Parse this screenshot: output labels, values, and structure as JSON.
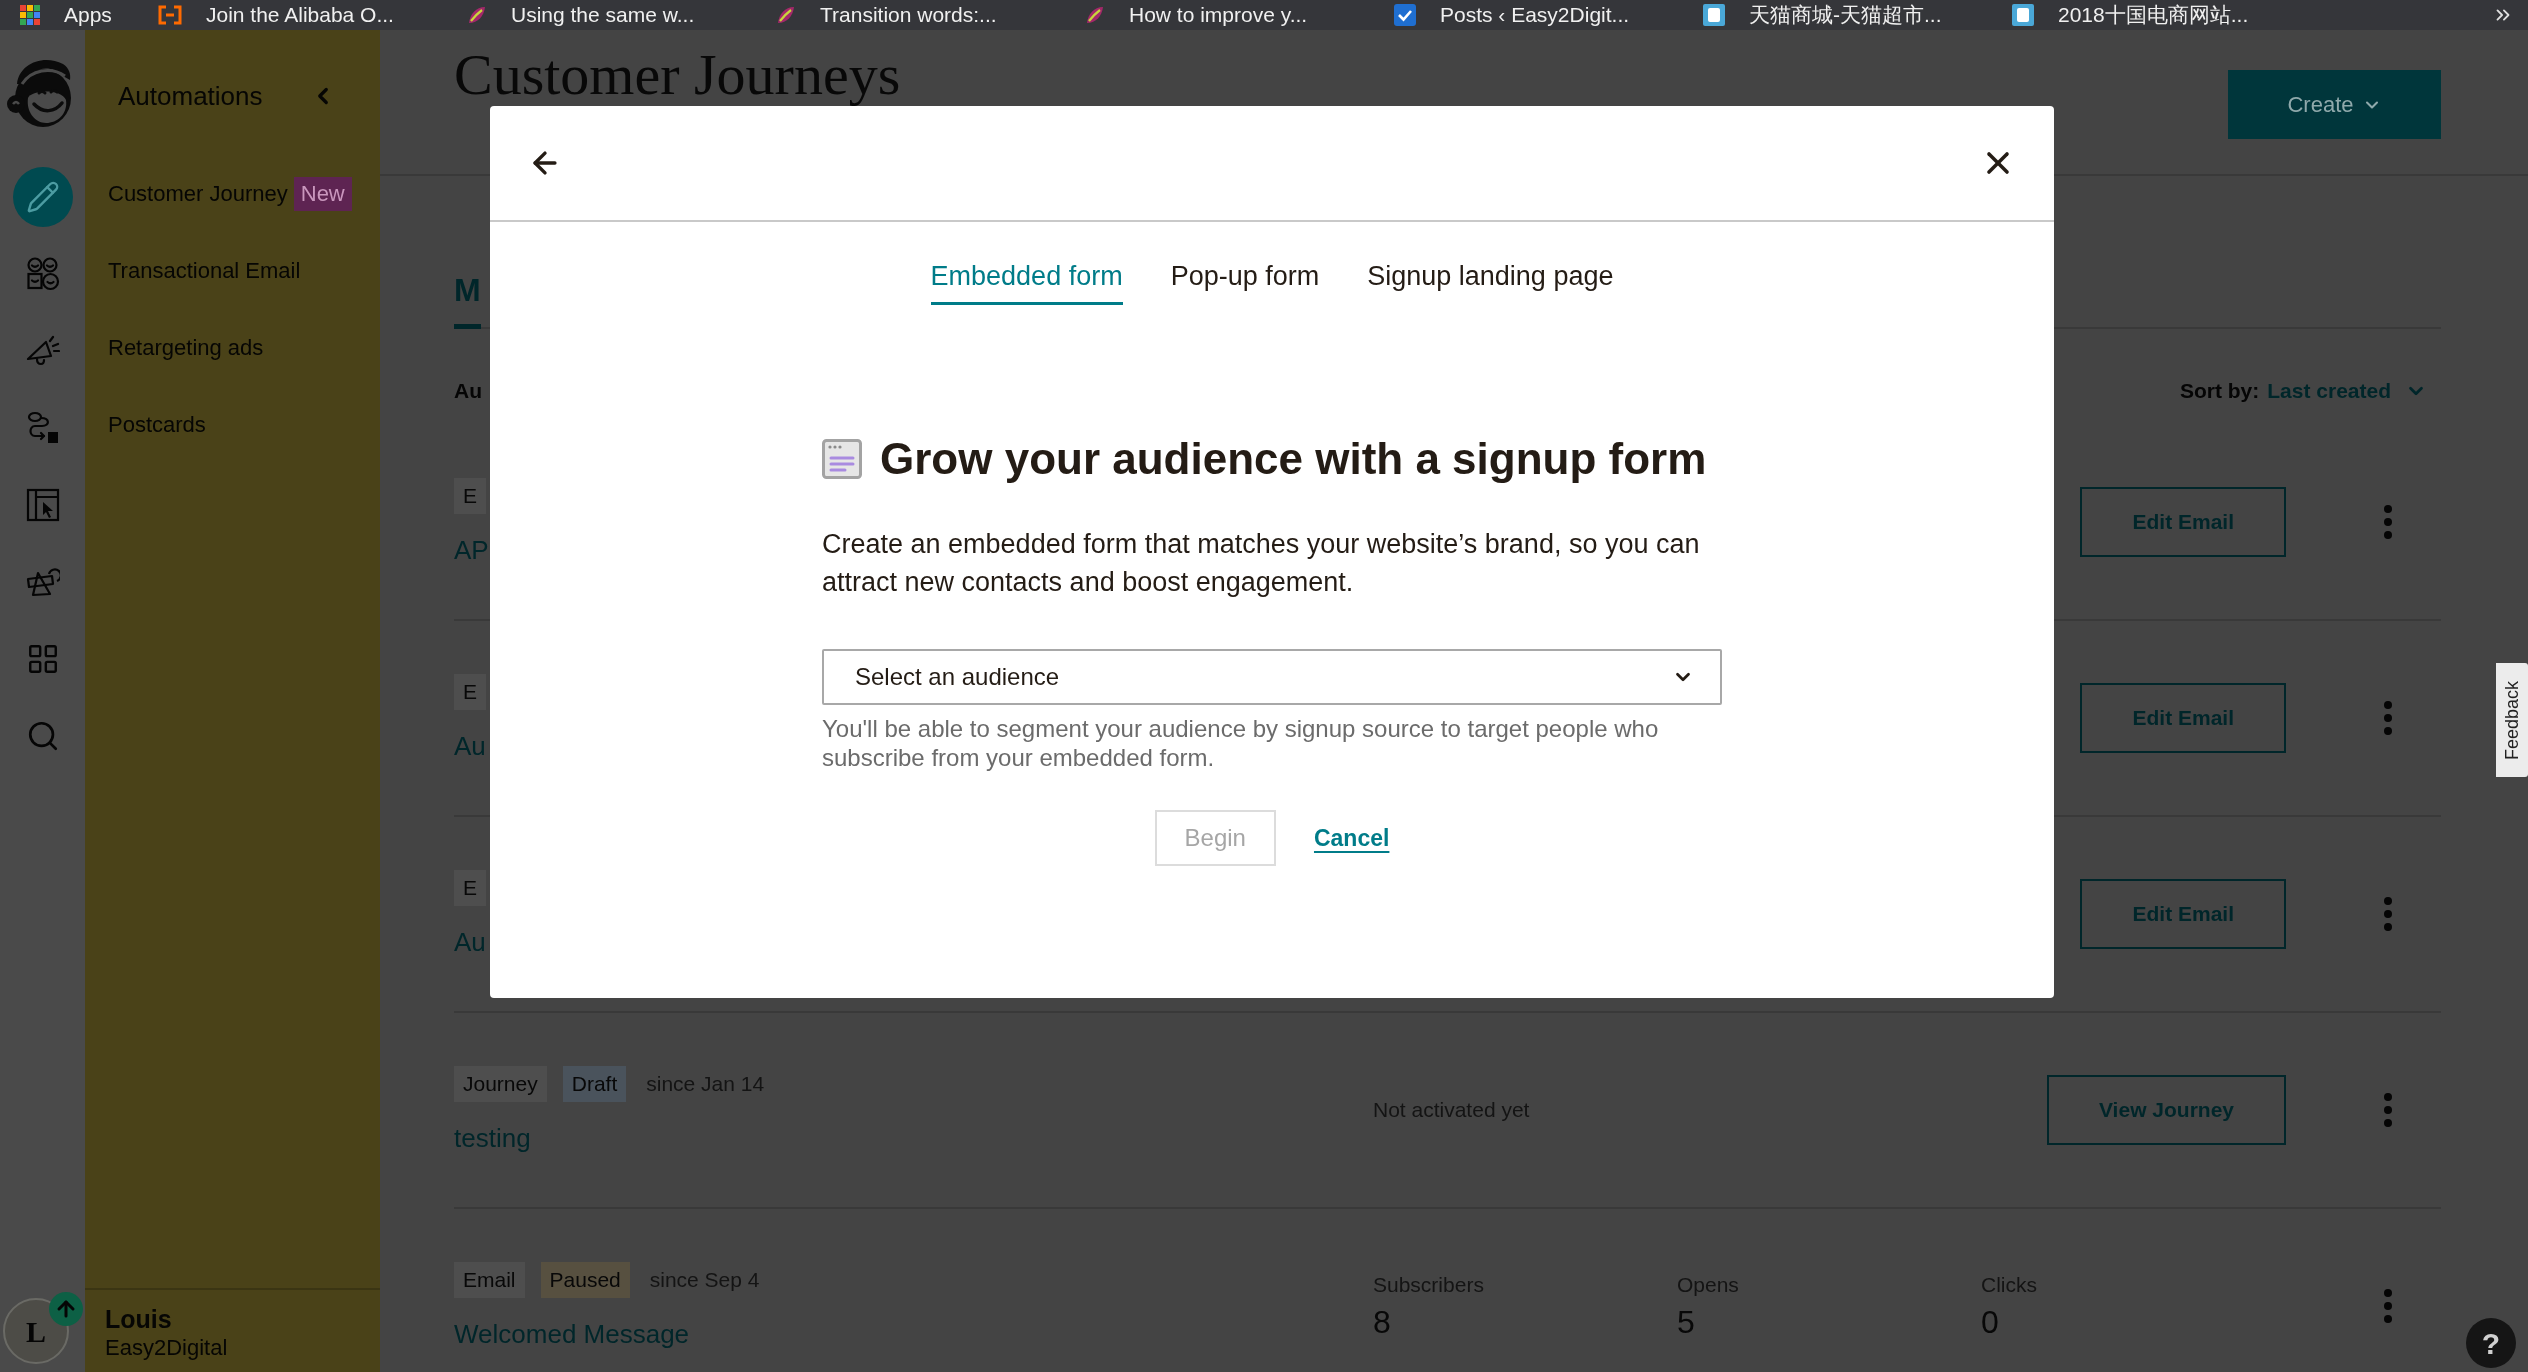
{
  "bookmarks": [
    {
      "label": "Apps"
    },
    {
      "label": "Join the Alibaba O..."
    },
    {
      "label": "Using the same w..."
    },
    {
      "label": "Transition words:..."
    },
    {
      "label": "How to improve y..."
    },
    {
      "label": "Posts ‹ Easy2Digit..."
    },
    {
      "label": "天猫商城-天猫超市..."
    },
    {
      "label": "2018十国电商网站..."
    }
  ],
  "rail": {
    "items": [
      {
        "selected": true
      },
      {
        "selected": false
      },
      {
        "selected": false
      },
      {
        "selected": false
      },
      {
        "selected": false
      },
      {
        "selected": false
      },
      {
        "selected": false
      },
      {
        "selected": false
      }
    ],
    "avatar": {
      "initial": "L"
    }
  },
  "sidebar": {
    "title": "Automations",
    "items": [
      {
        "label": "Customer Journey",
        "badge": "New"
      },
      {
        "label": "Transactional Email"
      },
      {
        "label": "Retargeting ads"
      },
      {
        "label": "Postcards"
      }
    ],
    "user": {
      "name": "Louis",
      "account": "Easy2Digital"
    }
  },
  "page": {
    "title": "Customer Journeys",
    "create_button": "Create",
    "tabs": [
      {
        "label": "M",
        "selected": true
      }
    ],
    "filter_label": "Au",
    "sort_label": "Sort by:",
    "sort_value": "Last created"
  },
  "rows": [
    {
      "tags": [
        {
          "label": "E",
          "kind": "type"
        }
      ],
      "name": "AP",
      "button": "Edit Email"
    },
    {
      "tags": [
        {
          "label": "E",
          "kind": "type"
        }
      ],
      "name": "Au",
      "button": "Edit Email"
    },
    {
      "tags": [
        {
          "label": "E",
          "kind": "type"
        }
      ],
      "name": "Au",
      "button": "Edit Email"
    },
    {
      "tags": [
        {
          "label": "Journey",
          "kind": "type"
        },
        {
          "label": "Draft",
          "kind": "draft"
        }
      ],
      "since": "since Jan 14",
      "name": "testing",
      "status": "Not activated yet",
      "button": "View Journey"
    },
    {
      "tags": [
        {
          "label": "Email",
          "kind": "type"
        },
        {
          "label": "Paused",
          "kind": "paused"
        }
      ],
      "since": "since Sep 4",
      "name": "Welcomed Message",
      "stats": [
        {
          "label": "Subscribers",
          "value": "8"
        },
        {
          "label": "Opens",
          "value": "5"
        },
        {
          "label": "Clicks",
          "value": "0"
        }
      ]
    }
  ],
  "feedback_tab": "Feedback",
  "help_button": "?",
  "modal": {
    "tabs": [
      {
        "label": "Embedded form",
        "selected": true
      },
      {
        "label": "Pop-up form",
        "selected": false
      },
      {
        "label": "Signup landing page",
        "selected": false
      }
    ],
    "heading": "Grow your audience with a signup form",
    "description": "Create an embedded form that matches your website’s brand, so you can attract new contacts and boost engagement.",
    "select": {
      "placeholder": "Select an audience"
    },
    "hint": "You'll be able to segment your audience by signup source to target people who subscribe from your embedded form.",
    "buttons": [
      {
        "label": "Begin",
        "kind": "button",
        "disabled": true
      },
      {
        "label": "Cancel",
        "kind": "link",
        "disabled": false
      }
    ]
  }
}
